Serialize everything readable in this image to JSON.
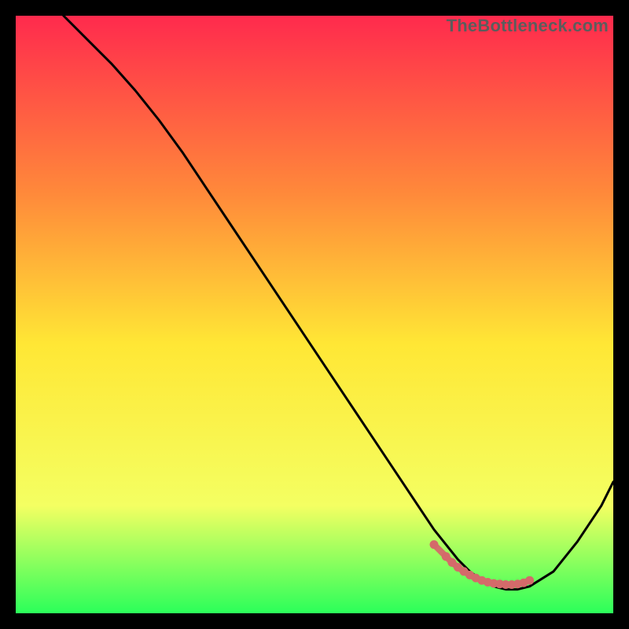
{
  "watermark": "TheBottleneck.com",
  "colors": {
    "gradient_top": "#ff2a4d",
    "gradient_mid1": "#ff8a3a",
    "gradient_mid2": "#ffe735",
    "gradient_mid3": "#f4ff62",
    "gradient_bottom": "#2bff5a",
    "curve": "#000000",
    "markers": "#d46a6a",
    "marker_fill": "#d46a6a"
  },
  "chart_data": {
    "type": "line",
    "title": "",
    "xlabel": "",
    "ylabel": "",
    "xlim": [
      0,
      100
    ],
    "ylim": [
      0,
      100
    ],
    "grid": false,
    "legend": false,
    "series": [
      {
        "name": "bottleneck-curve",
        "x": [
          8,
          12,
          16,
          20,
          24,
          28,
          32,
          36,
          40,
          44,
          48,
          52,
          56,
          60,
          64,
          68,
          70,
          72,
          74,
          76,
          78,
          80,
          82,
          84,
          86,
          90,
          94,
          98,
          100
        ],
        "values": [
          100,
          96,
          92,
          87.5,
          82.5,
          77,
          71,
          65,
          59,
          53,
          47,
          41,
          35,
          29,
          23,
          17,
          14,
          11.5,
          9,
          7,
          5.5,
          4.5,
          4,
          4,
          4.5,
          7,
          12,
          18,
          22
        ]
      }
    ],
    "highlight_markers": {
      "name": "optimal-zone-markers",
      "x": [
        70,
        72,
        73,
        74,
        75,
        76,
        77,
        78,
        79,
        80,
        81,
        82,
        83,
        84,
        85,
        86
      ],
      "values": [
        11.5,
        9.5,
        8.5,
        7.7,
        7.0,
        6.4,
        5.9,
        5.5,
        5.2,
        5.0,
        4.9,
        4.8,
        4.8,
        4.9,
        5.1,
        5.5
      ]
    }
  }
}
